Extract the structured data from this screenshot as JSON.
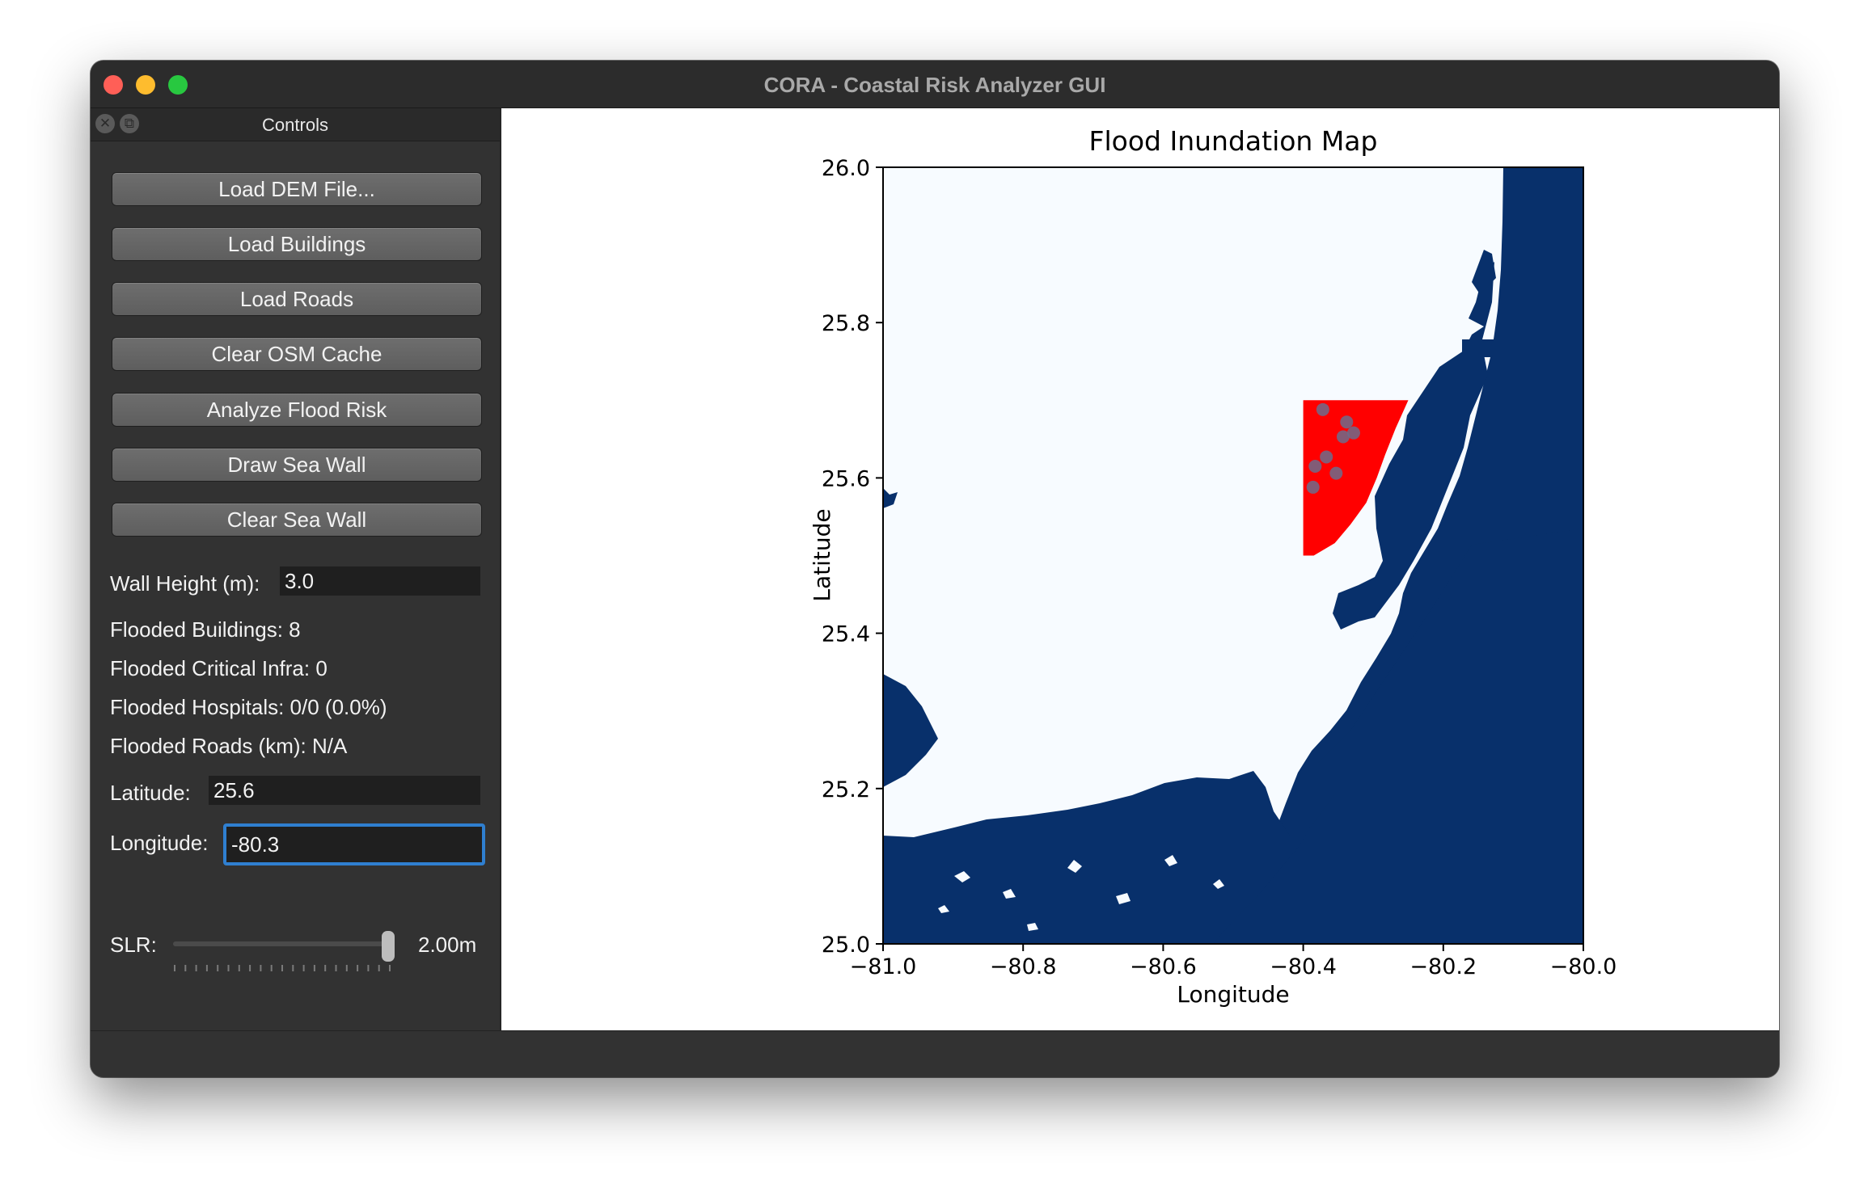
{
  "window": {
    "title": "CORA - Coastal Risk Analyzer GUI"
  },
  "controls": {
    "title": "Controls",
    "close_glyph": "✕",
    "float_glyph": "⧉",
    "buttons": [
      {
        "label": "Load DEM File..."
      },
      {
        "label": "Load Buildings"
      },
      {
        "label": "Load Roads"
      },
      {
        "label": "Clear OSM Cache"
      },
      {
        "label": "Analyze Flood Risk"
      },
      {
        "label": "Draw Sea Wall"
      },
      {
        "label": "Clear Sea Wall"
      }
    ],
    "wall_height": {
      "label": "Wall Height (m):",
      "value": "3.0"
    },
    "stats": {
      "flooded_buildings": "Flooded Buildings: 8",
      "flooded_critical_infra": "Flooded Critical Infra: 0",
      "flooded_hospitals": "Flooded Hospitals: 0/0 (0.0%)",
      "flooded_roads": "Flooded Roads (km): N/A"
    },
    "latitude": {
      "label": "Latitude:",
      "value": "25.6"
    },
    "longitude": {
      "label": "Longitude:",
      "value": "-80.3"
    },
    "slr": {
      "label": "SLR:",
      "value_text": "2.00m",
      "level_fraction": 1.0
    }
  },
  "chart_data": {
    "type": "heatmap",
    "title": "Flood Inundation Map",
    "xlabel": "Longitude",
    "ylabel": "Latitude",
    "xlim": [
      -81.0,
      -80.0
    ],
    "ylim": [
      25.0,
      26.0
    ],
    "x_ticks": [
      "−81.0",
      "−80.8",
      "−80.6",
      "−80.4",
      "−80.2",
      "−80.0"
    ],
    "y_ticks": [
      "25.0",
      "25.2",
      "25.4",
      "25.6",
      "25.8",
      "26.0"
    ],
    "colors": {
      "water": "#08306b",
      "land": "#f7fbff",
      "flooded": "#ff0000",
      "building": "#6c6c8c"
    },
    "flood_extent": {
      "lon": [
        -80.4,
        -80.25
      ],
      "lat": [
        25.5,
        25.7
      ]
    },
    "flooded_buildings": [
      {
        "lon": -80.372,
        "lat": 25.688
      },
      {
        "lon": -80.338,
        "lat": 25.672
      },
      {
        "lon": -80.328,
        "lat": 25.658
      },
      {
        "lon": -80.343,
        "lat": 25.653
      },
      {
        "lon": -80.367,
        "lat": 25.627
      },
      {
        "lon": -80.383,
        "lat": 25.615
      },
      {
        "lon": -80.353,
        "lat": 25.606
      },
      {
        "lon": -80.386,
        "lat": 25.588
      }
    ]
  }
}
